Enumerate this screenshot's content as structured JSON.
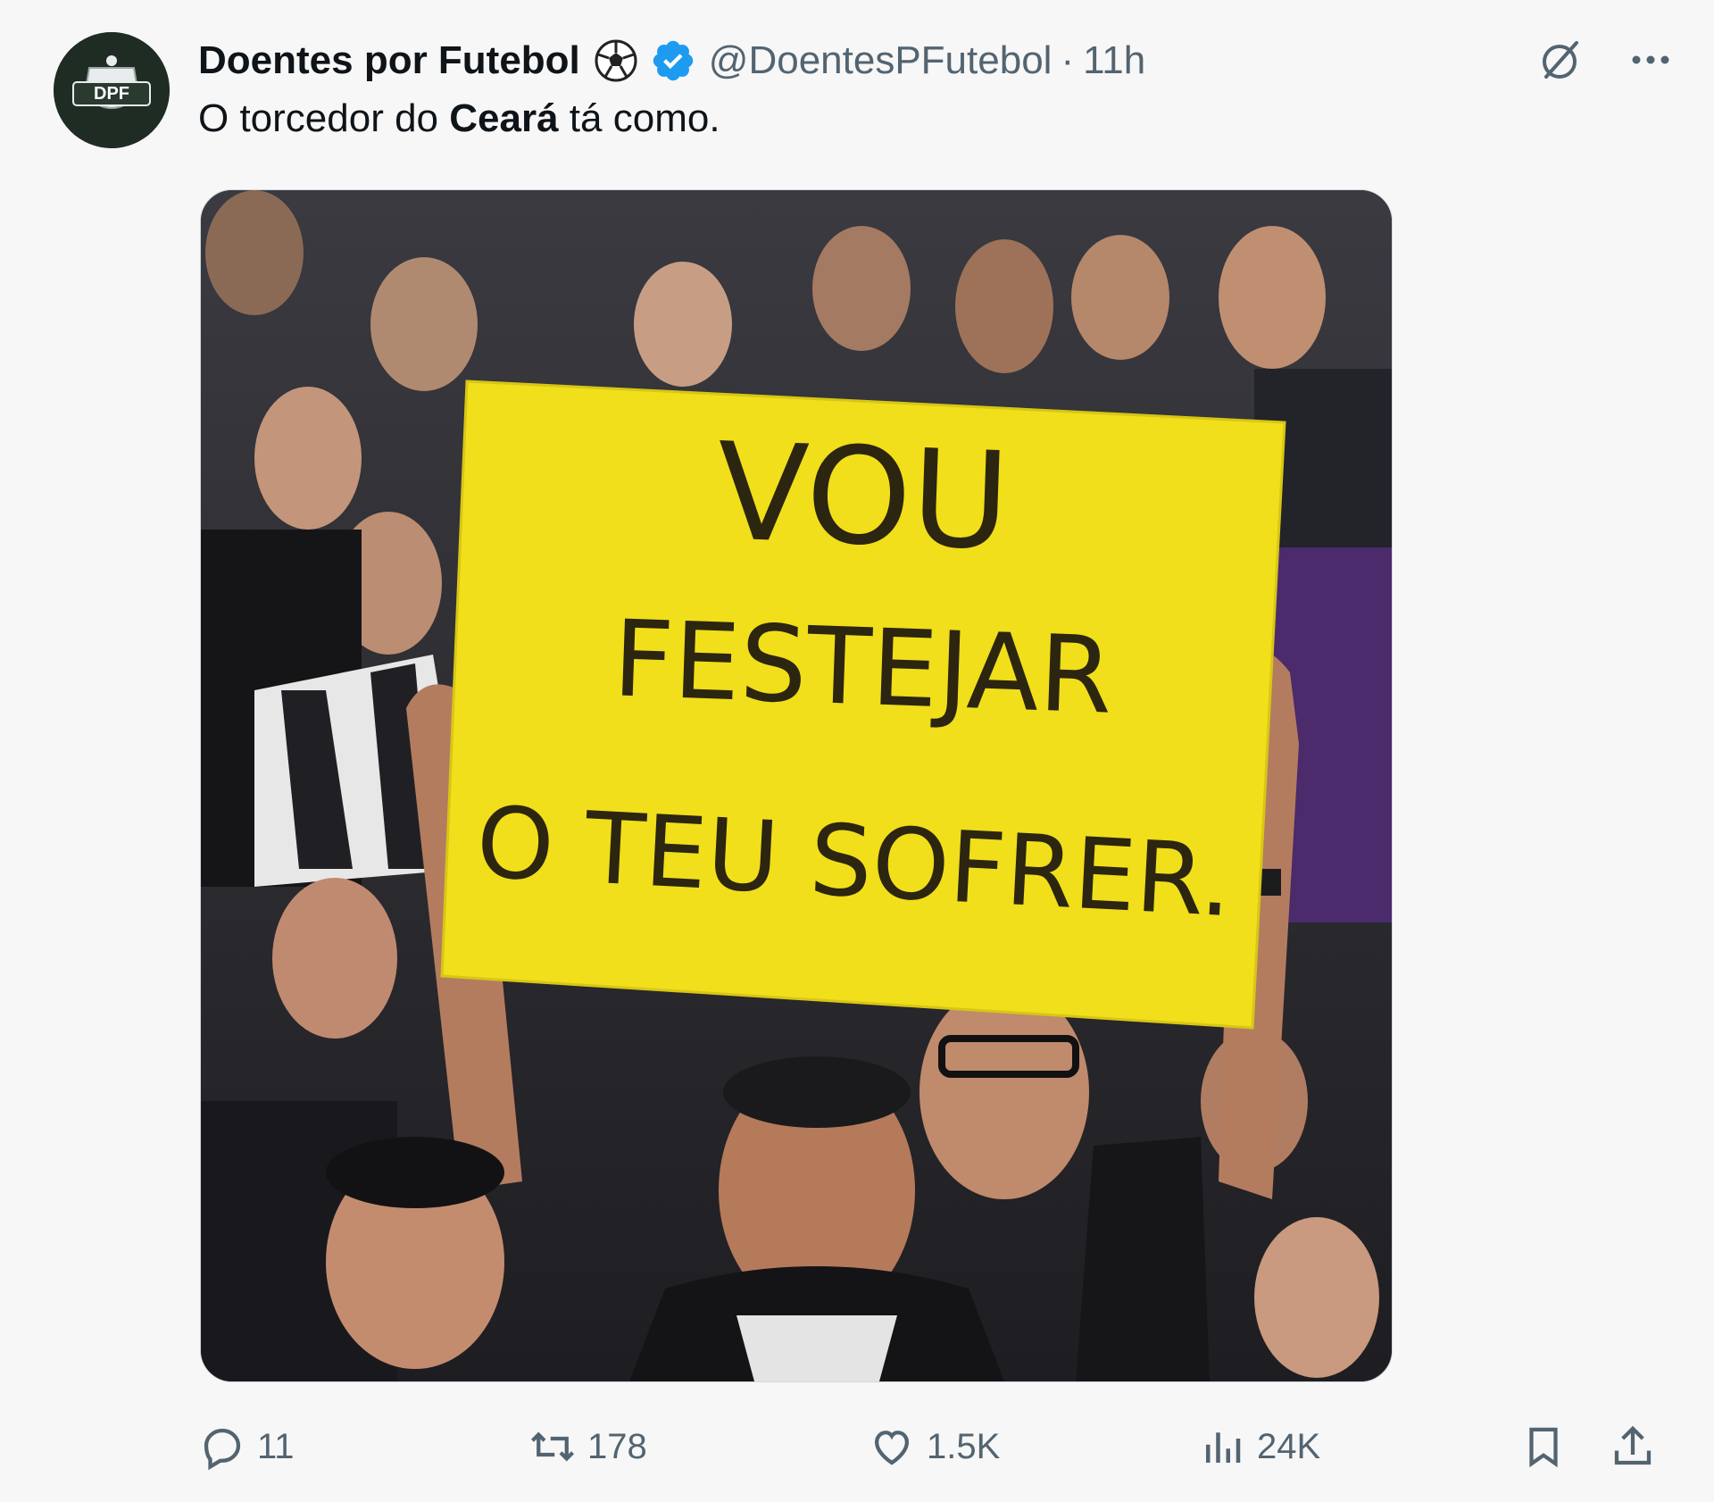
{
  "author": {
    "display_name": "Doentes por Futebol",
    "handle": "@DoentesPFutebol",
    "separator": "·",
    "time": "11h",
    "avatar_text": "DPF",
    "name_emoji": "soccer-ball-icon",
    "verified_icon": "verified-badge-icon"
  },
  "tweet": {
    "text_before": "O torcedor do ",
    "text_bold": "Ceará",
    "text_after": " tá como."
  },
  "media": {
    "sign_line_1": "VOU",
    "sign_line_2": "FESTEJAR",
    "sign_line_3": "O TEU SOFRER."
  },
  "top_actions": {
    "grok_icon": "grok-icon",
    "more_icon": "more-options-icon"
  },
  "actions": {
    "replies": "11",
    "reposts": "178",
    "likes": "1.5K",
    "views": "24K"
  },
  "colors": {
    "verified": "#1d9bf0",
    "muted": "#536471",
    "text": "#0f1419",
    "sign_yellow": "#f0df1a"
  }
}
